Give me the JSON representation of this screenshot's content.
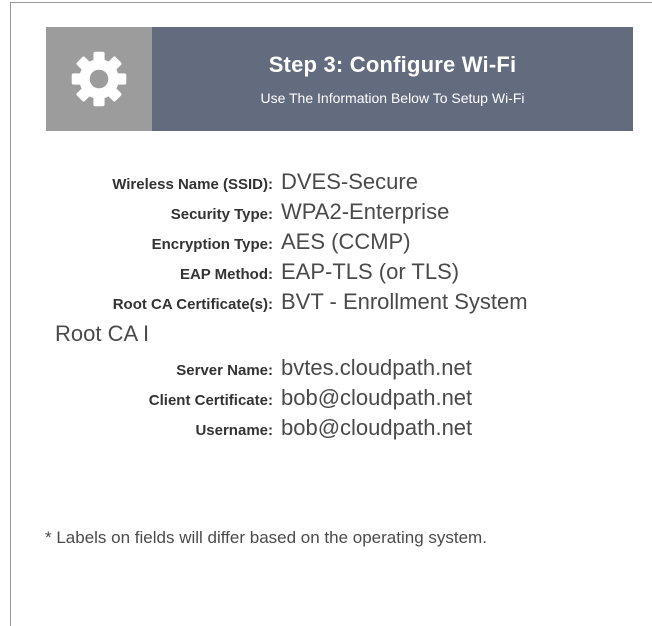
{
  "banner": {
    "icon": "gear-icon",
    "title": "Step 3: Configure Wi-Fi",
    "subtitle": "Use The Information Below To Setup Wi-Fi",
    "colors": {
      "icon_bg": "#9c9c9c",
      "title_bg": "#636b7f"
    }
  },
  "fields": {
    "ssid": {
      "label": "Wireless Name (SSID):",
      "value": "DVES-Secure"
    },
    "security": {
      "label": "Security Type:",
      "value": "WPA2-Enterprise"
    },
    "encryption": {
      "label": "Encryption Type:",
      "value": "AES (CCMP)"
    },
    "eap": {
      "label": "EAP Method:",
      "value": "EAP-TLS (or TLS)"
    },
    "root_ca": {
      "label": "Root CA Certificate(s):",
      "value": "BVT - Enrollment System",
      "value_cont": "Root CA I"
    },
    "server": {
      "label": "Server Name:",
      "value": "bvtes.cloudpath.net"
    },
    "client_cert": {
      "label": "Client Certificate:",
      "value": "bob@cloudpath.net"
    },
    "username": {
      "label": "Username:",
      "value": "bob@cloudpath.net"
    }
  },
  "footnote": "* Labels on fields will differ based on the operating system."
}
